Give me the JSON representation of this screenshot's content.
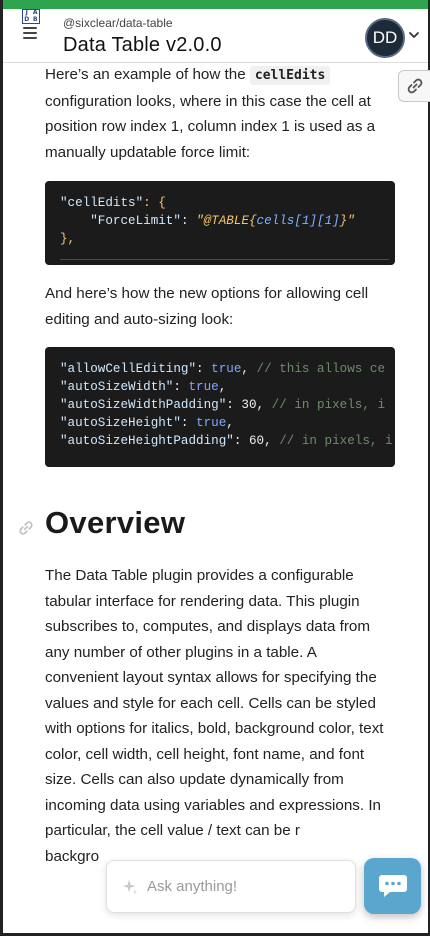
{
  "header": {
    "logo_letters": [
      "J",
      "A",
      "D",
      "B"
    ],
    "package": "@sixclear/data-table",
    "title": "Data Table v2.0.0",
    "avatar_initials": "DD"
  },
  "intro": {
    "before_code": "Here’s an example of how the ",
    "code": "cellEdits",
    "after_code": " configuration looks, where in this case the cell at position row index 1, column index 1 is used as a manually updatable force limit:"
  },
  "code1": {
    "l1_key": "\"cellEdits\"",
    "l1_rest": ": {",
    "l2_key": "\"ForceLimit\"",
    "l2_colon": ": ",
    "l2_val_a": "\"@TABLE{",
    "l2_val_b": "cells[1][1]",
    "l2_val_c": "}\"",
    "l3": "},"
  },
  "between": "And here’s how the new options for allowing cell editing and auto-sizing look:",
  "code2": {
    "lines": [
      {
        "key": "\"allowCellEditing\"",
        "sep": ": ",
        "val": "true",
        "tail": ", ",
        "comment": "// this allows ce"
      },
      {
        "key": "\"autoSizeWidth\"",
        "sep": ": ",
        "val": "true",
        "tail": ",",
        "comment": ""
      },
      {
        "key": "\"autoSizeWidthPadding\"",
        "sep": ": ",
        "val": "30",
        "tail": ", ",
        "comment": "// in pixels, i"
      },
      {
        "key": "\"autoSizeHeight\"",
        "sep": ": ",
        "val": "true",
        "tail": ",",
        "comment": ""
      },
      {
        "key": "\"autoSizeHeightPadding\"",
        "sep": ": ",
        "val": "60",
        "tail": ", ",
        "comment": "// in pixels, i"
      }
    ]
  },
  "overview": {
    "heading": "Overview",
    "body": "The Data Table plugin provides a configurable tabular interface for rendering data. This plugin subscribes to, computes, and displays data from any number of other plugins in a table. A convenient layout syntax allows for specifying the values and style for each cell. Cells can be styled with options for italics, bold, background color, text color, cell width, cell height, font name, and font size. Cells can also update dynamically from incoming data using variables and expressions. In particular, the cell value / text can be r",
    "tail": "backgro"
  },
  "chat": {
    "placeholder": "Ask anything!"
  },
  "colors": {
    "accent_green": "#2ea44f",
    "code_bg": "#1b1b1b",
    "chat_button": "#5aa6cf"
  }
}
